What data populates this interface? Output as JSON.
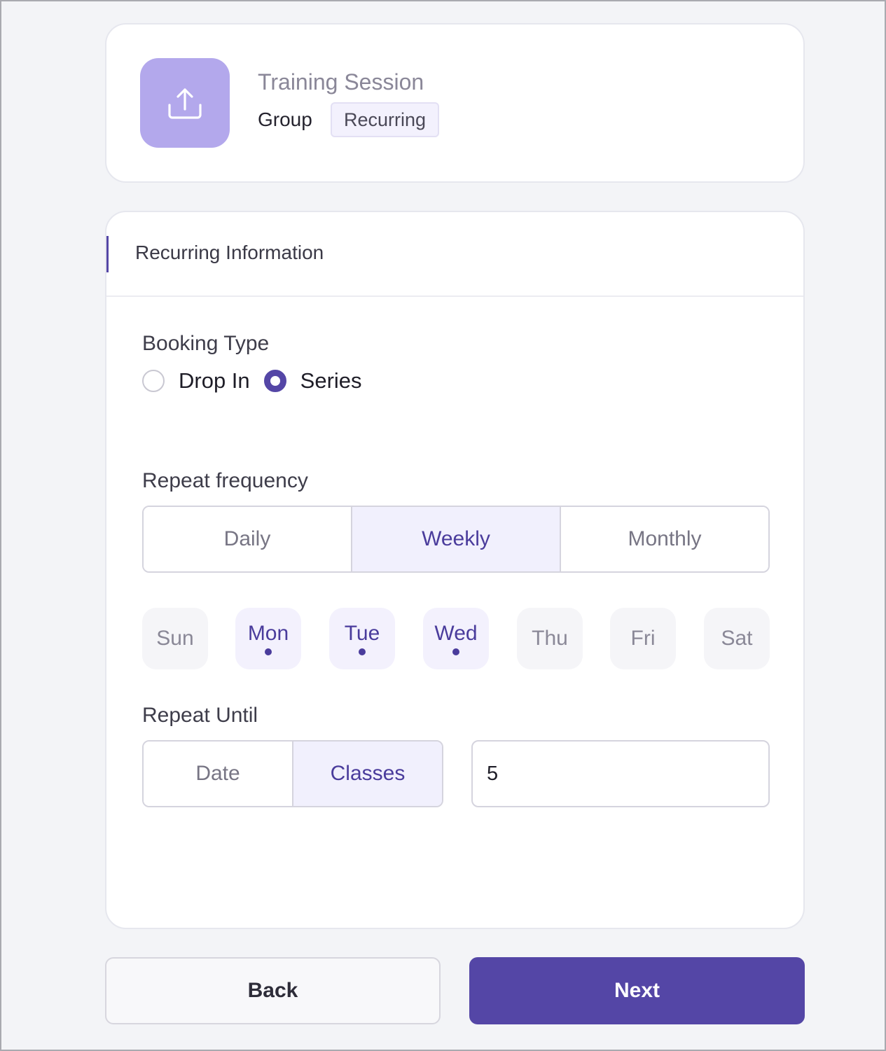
{
  "session": {
    "icon": "upload-icon",
    "title": "Training Session",
    "type": "Group",
    "badge": "Recurring"
  },
  "recurring": {
    "section_title": "Recurring Information",
    "booking_type": {
      "label": "Booking Type",
      "options": [
        "Drop In",
        "Series"
      ],
      "selected": "Series"
    },
    "repeat_frequency": {
      "label": "Repeat frequency",
      "options": [
        "Daily",
        "Weekly",
        "Monthly"
      ],
      "selected": "Weekly"
    },
    "days": {
      "items": [
        "Sun",
        "Mon",
        "Tue",
        "Wed",
        "Thu",
        "Fri",
        "Sat"
      ],
      "selected": [
        "Mon",
        "Tue",
        "Wed"
      ]
    },
    "repeat_until": {
      "label": "Repeat Until",
      "options": [
        "Date",
        "Classes"
      ],
      "selected": "Classes",
      "count_value": "5"
    }
  },
  "actions": {
    "back_label": "Back",
    "next_label": "Next"
  },
  "colors": {
    "accent": "#5446a6",
    "icon_bg": "#b3a8ec",
    "selected_bg": "#f1f0fd"
  }
}
